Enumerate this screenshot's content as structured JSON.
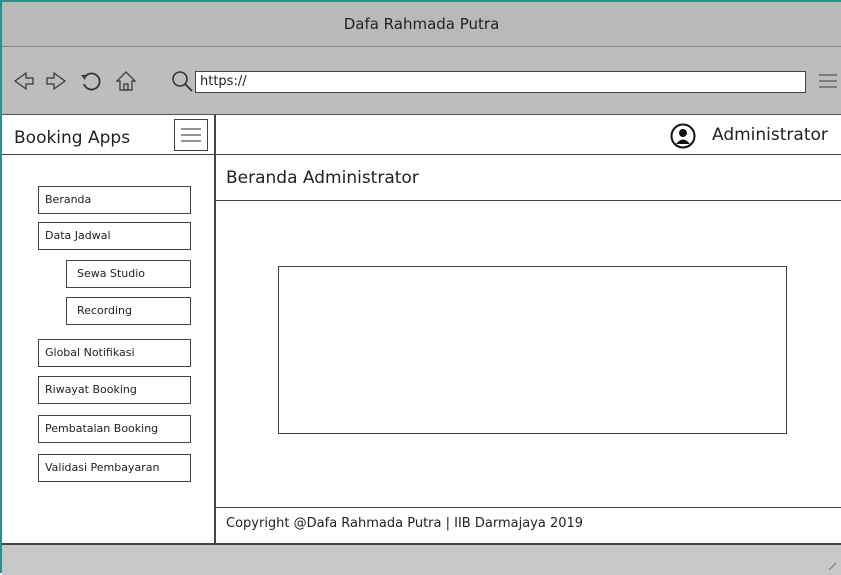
{
  "window": {
    "title": "Dafa Rahmada Putra"
  },
  "browser": {
    "url": "https://",
    "icons": [
      "back-arrow-icon",
      "forward-arrow-icon",
      "refresh-icon",
      "home-icon",
      "search-icon",
      "hamburger-menu-icon"
    ]
  },
  "sidebar": {
    "brand": "Booking Apps",
    "items": [
      {
        "label": "Beranda"
      },
      {
        "label": "Data Jadwal"
      },
      {
        "label": "Sewa Studio"
      },
      {
        "label": "Recording"
      },
      {
        "label": "Global Notifikasi"
      },
      {
        "label": "Riwayat Booking"
      },
      {
        "label": "Pembatalan Booking"
      },
      {
        "label": "Validasi Pembayaran"
      }
    ]
  },
  "header": {
    "user": "Administrator"
  },
  "main": {
    "title": "Beranda Administrator"
  },
  "footer": {
    "text": "Copyright @Dafa Rahmada Putra | IIB Darmajaya 2019"
  }
}
